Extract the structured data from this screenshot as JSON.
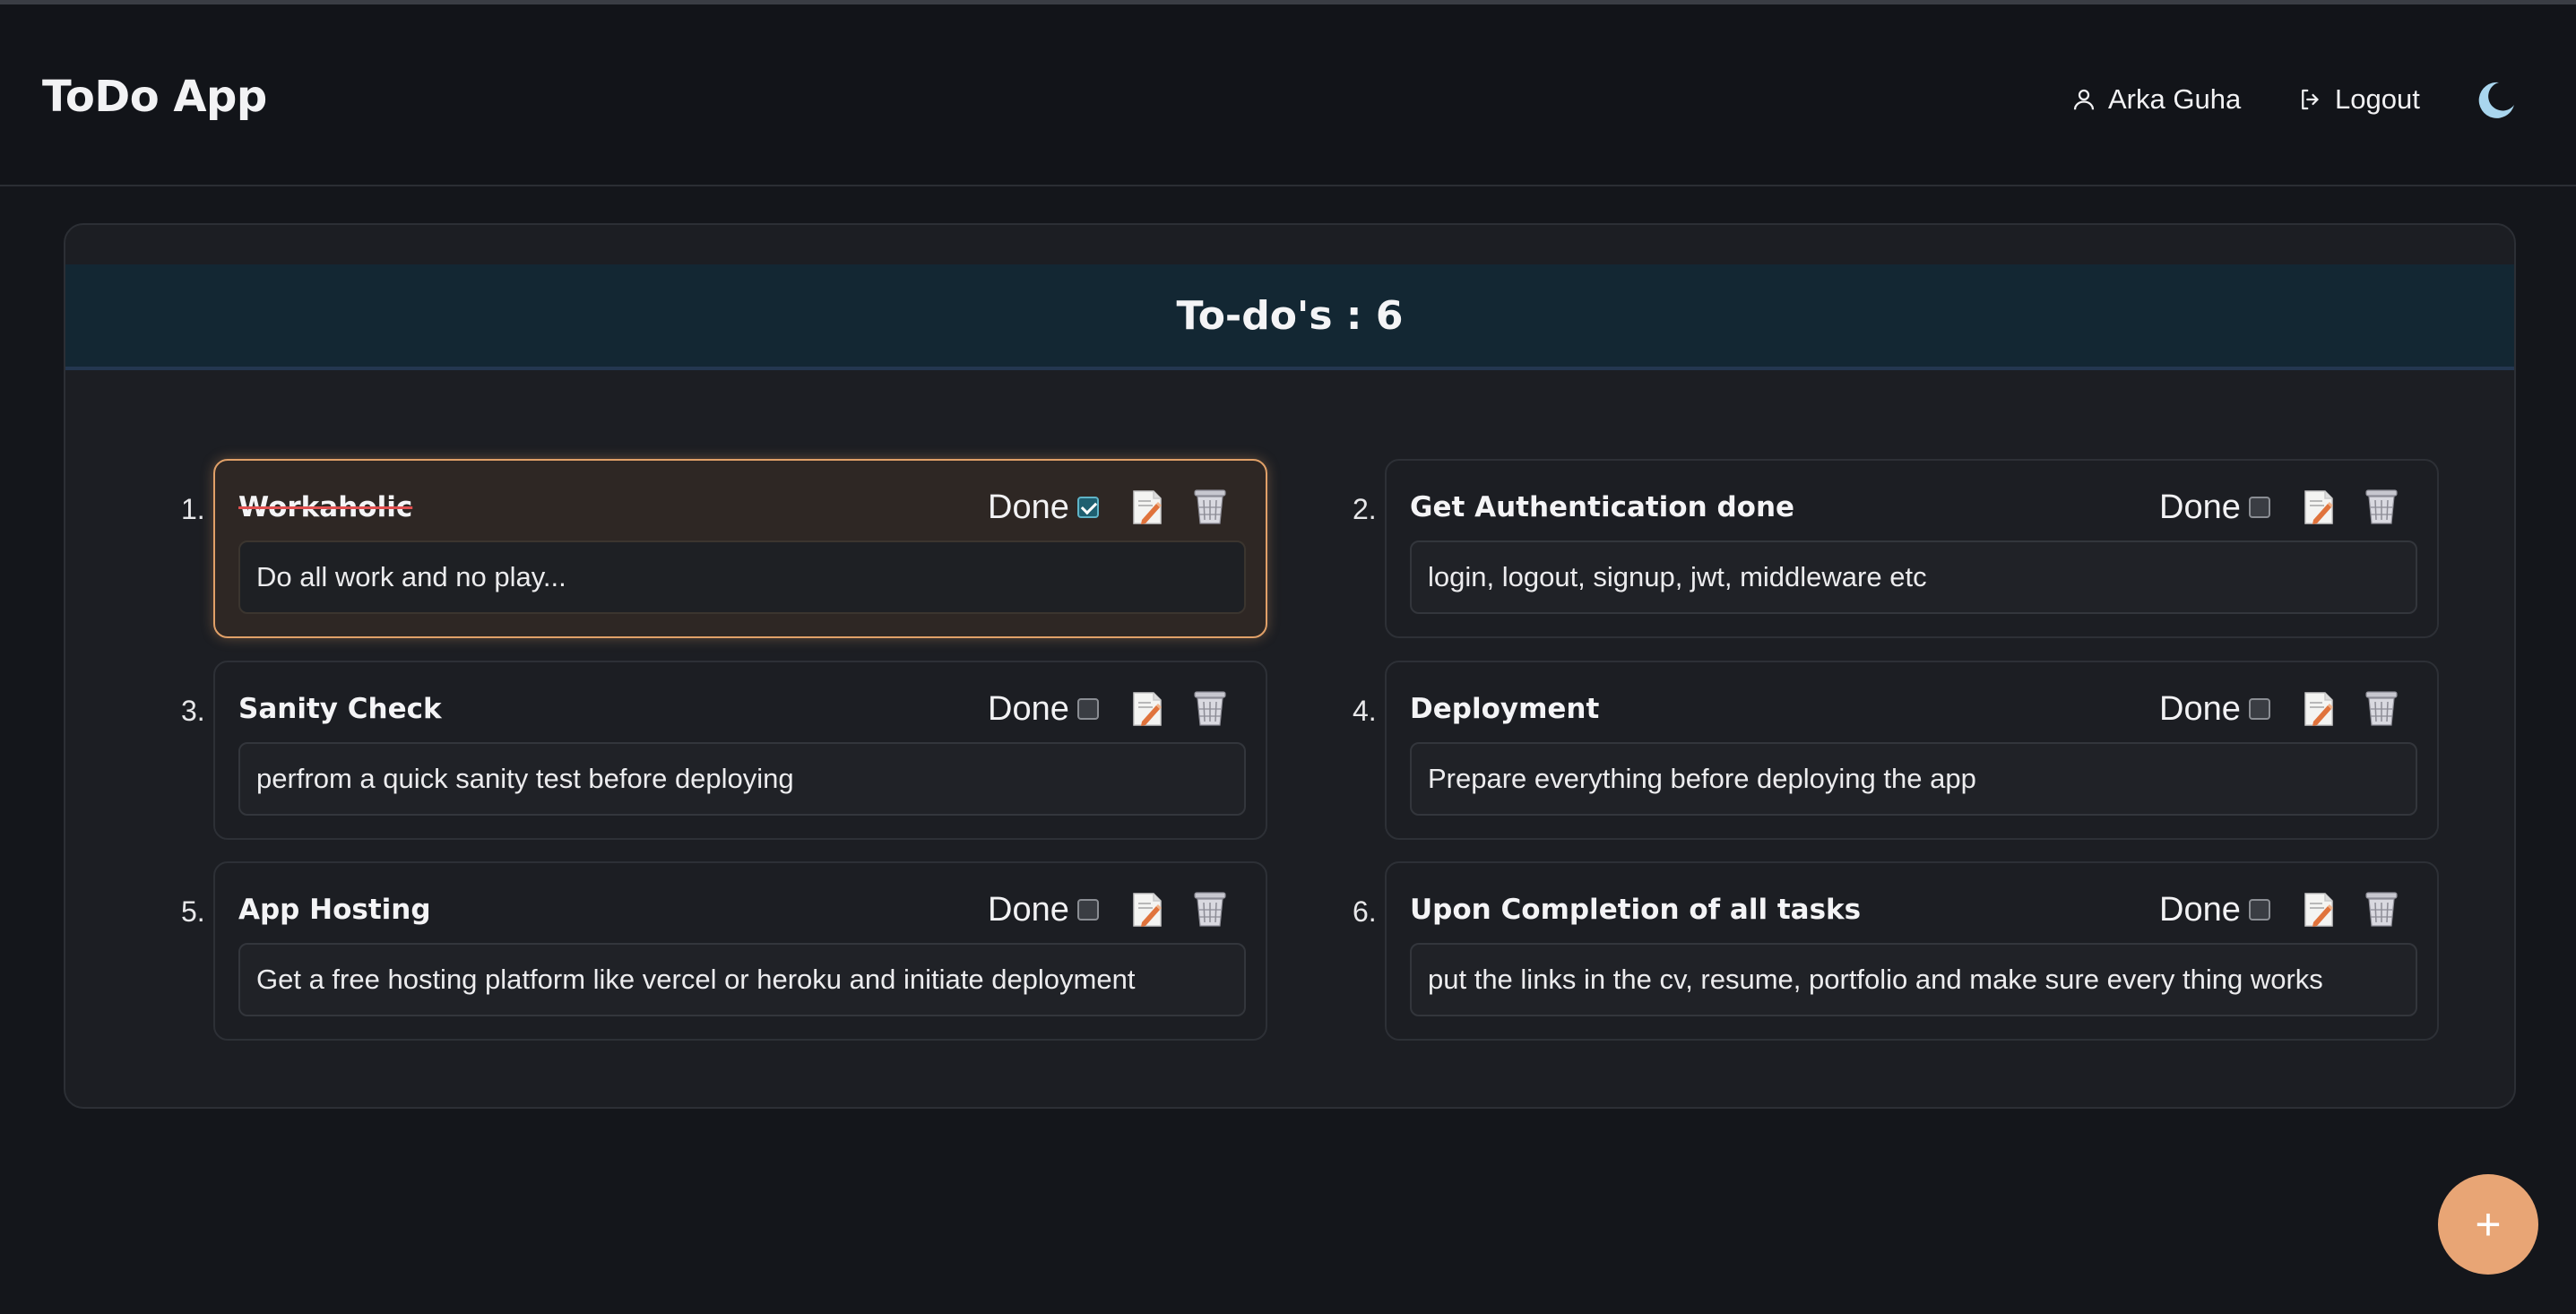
{
  "app": {
    "title": "ToDo App"
  },
  "nav": {
    "user_name": "Arka Guha",
    "logout_label": "Logout",
    "theme_icon": "moon-icon"
  },
  "panel": {
    "title_prefix": "To-do's :",
    "count": "6"
  },
  "todos": [
    {
      "number": "1.",
      "title": "Workaholic",
      "description": "Do all work and no play...",
      "done_label": "Done",
      "done": true
    },
    {
      "number": "2.",
      "title": "Get Authentication done",
      "description": "login, logout, signup, jwt, middleware etc",
      "done_label": "Done",
      "done": false
    },
    {
      "number": "3.",
      "title": "Sanity Check",
      "description": "perfrom a quick sanity test before deploying",
      "done_label": "Done",
      "done": false
    },
    {
      "number": "4.",
      "title": "Deployment",
      "description": "Prepare everything before deploying the app",
      "done_label": "Done",
      "done": false
    },
    {
      "number": "5.",
      "title": "App Hosting",
      "description": "Get a free hosting platform like vercel or heroku and initiate deployment",
      "done_label": "Done",
      "done": false
    },
    {
      "number": "6.",
      "title": "Upon Completion of all tasks",
      "description": "put the links in the cv, resume, portfolio and make sure every thing works",
      "done_label": "Done",
      "done": false
    }
  ],
  "fab": {
    "label": "+"
  },
  "colors": {
    "background": "#14161b",
    "accent": "#e8a575",
    "header_band": "#132733",
    "completed_border": "#e0a068"
  }
}
